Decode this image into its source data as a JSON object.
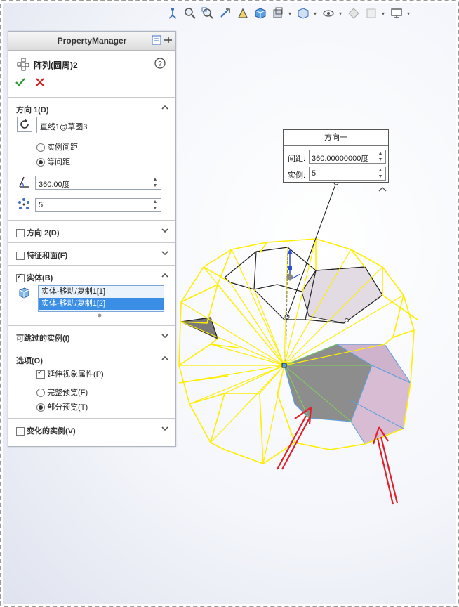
{
  "toolbar": {
    "icons": [
      "view-orient-icon",
      "zoom-fit-icon",
      "zoom-area-icon",
      "previous-view-icon",
      "section-view-icon",
      "view-cube-icon",
      "display-style-icon",
      "hide-show-icon",
      "appearance-icon",
      "scene-icon",
      "monitor-icon"
    ]
  },
  "pm": {
    "header": "PropertyManager",
    "feature_title": "阵列(圆周)2",
    "direction1": {
      "title": "方向 1(D)",
      "axis_value": "直线1@草图3",
      "radio_instance_spacing": "实例间距",
      "radio_equal_spacing": "等间距",
      "angle_value": "360.00度",
      "count_value": "5"
    },
    "direction2": {
      "title": "方向 2(D)"
    },
    "features_faces": {
      "title": "特征和面(F)"
    },
    "bodies": {
      "title": "实体(B)",
      "items": [
        "实体-移动/复制1[1]",
        "实体-移动/复制1[2]"
      ]
    },
    "skip": {
      "title": "可跳过的实例(I)"
    },
    "options": {
      "title": "选项(O)",
      "propagate": "延伸视象属性(P)",
      "full_preview": "完整预览(F)",
      "partial_preview": "部分预览(T)"
    },
    "vary": {
      "title": "变化的实例(V)"
    }
  },
  "callout": {
    "title": "方向一",
    "spacing_label": "间距:",
    "spacing_value": "360.00000000度",
    "instances_label": "实例:",
    "instances_value": "5"
  },
  "colors": {
    "wire": "#ffee00",
    "arrow": "#e0202a",
    "accent": "#3a8ee6",
    "body_pink": "#d9bcd3",
    "body_gray": "#8a8a8a"
  }
}
